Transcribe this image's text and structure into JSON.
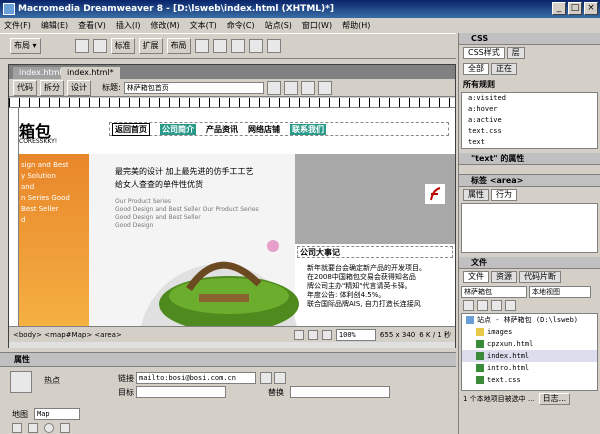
{
  "title": "Macromedia Dreamweaver 8 - [D:\\lsweb\\index.html (XHTML)*]",
  "menu": [
    "文件(F)",
    "编辑(E)",
    "查看(V)",
    "插入(I)",
    "修改(M)",
    "文本(T)",
    "命令(C)",
    "站点(S)",
    "窗口(W)",
    "帮助(H)"
  ],
  "insert": {
    "layout_label": "布局 ▾",
    "standard": "标准",
    "expand": "扩展",
    "layout": "布局"
  },
  "tabs": [
    "index.html",
    "index.html*"
  ],
  "doc_toolbar": {
    "code": "代码",
    "split": "拆分",
    "design": "设计",
    "title_label": "标题:",
    "title_value": "林萨箱包首页"
  },
  "page": {
    "logo": "箱包",
    "logo_sub": "CORESSKKY!",
    "nav": [
      "返回首页",
      "公司简介",
      "产品资讯",
      "网络店铺",
      "联系我们"
    ],
    "left_lines": [
      "sign and Best",
      "y Solution",
      "and",
      "n Series Good",
      "Best Seller",
      "d"
    ],
    "tagline1": "最完美的设计 加上最先进的仿手工工艺",
    "tagline2": "给女人查查的单件性优货",
    "series_title": "Our Product Series",
    "series_lines": [
      "Good Design and Best Seller Our Product Series",
      "Good Design and Best Seller",
      "Good Design"
    ],
    "news_title": "公司大事记",
    "news": [
      "新年就要台会确定新产品的开发项目。",
      "在2008中国箱包交易会获得知名品",
      "牌公司主办\"精知\"代言请英卡驿。",
      "年度公告: 体利创4.5%。",
      "联合国际品牌AIS, 自力打造长连接风"
    ]
  },
  "status": {
    "path": "<body> <map#Map> <area>",
    "zoom": "100%",
    "size": "655 x 340",
    "kb": "6 K / 1 秒"
  },
  "props": {
    "title": "属性",
    "hotspot": "热点",
    "link_label": "链接",
    "link_value": "mailto:bosi@bosi.com.cn",
    "target_label": "目标",
    "alt_label": "替换",
    "map_label": "地图",
    "map_value": "Map"
  },
  "css": {
    "header": "CSS",
    "tab_all": "CSS样式",
    "tab_layer": "层",
    "btn_all": "全部",
    "btn_current": "正在",
    "rules_title": "所有规则",
    "rules": [
      "a:visited",
      "a:hover",
      "a:active",
      "text.css",
      "text"
    ]
  },
  "props_panel": {
    "title": "\"text\" 的属性"
  },
  "tag_panel": {
    "title": "标签 <area>",
    "tab_attr": "属性",
    "tab_behavior": "行为"
  },
  "files": {
    "header": "文件",
    "tab_files": "文件",
    "tab_assets": "资源",
    "tab_snippets": "代码片断",
    "site": "林萨箱包",
    "view": "本地视图",
    "items": [
      "站点 - 林萨箱包 (D:\\lsweb)",
      "images",
      "cpzxun.html",
      "index.html",
      "intro.html",
      "text.css"
    ],
    "status": "1 个本地项目被选中 ...",
    "log": "日志..."
  }
}
